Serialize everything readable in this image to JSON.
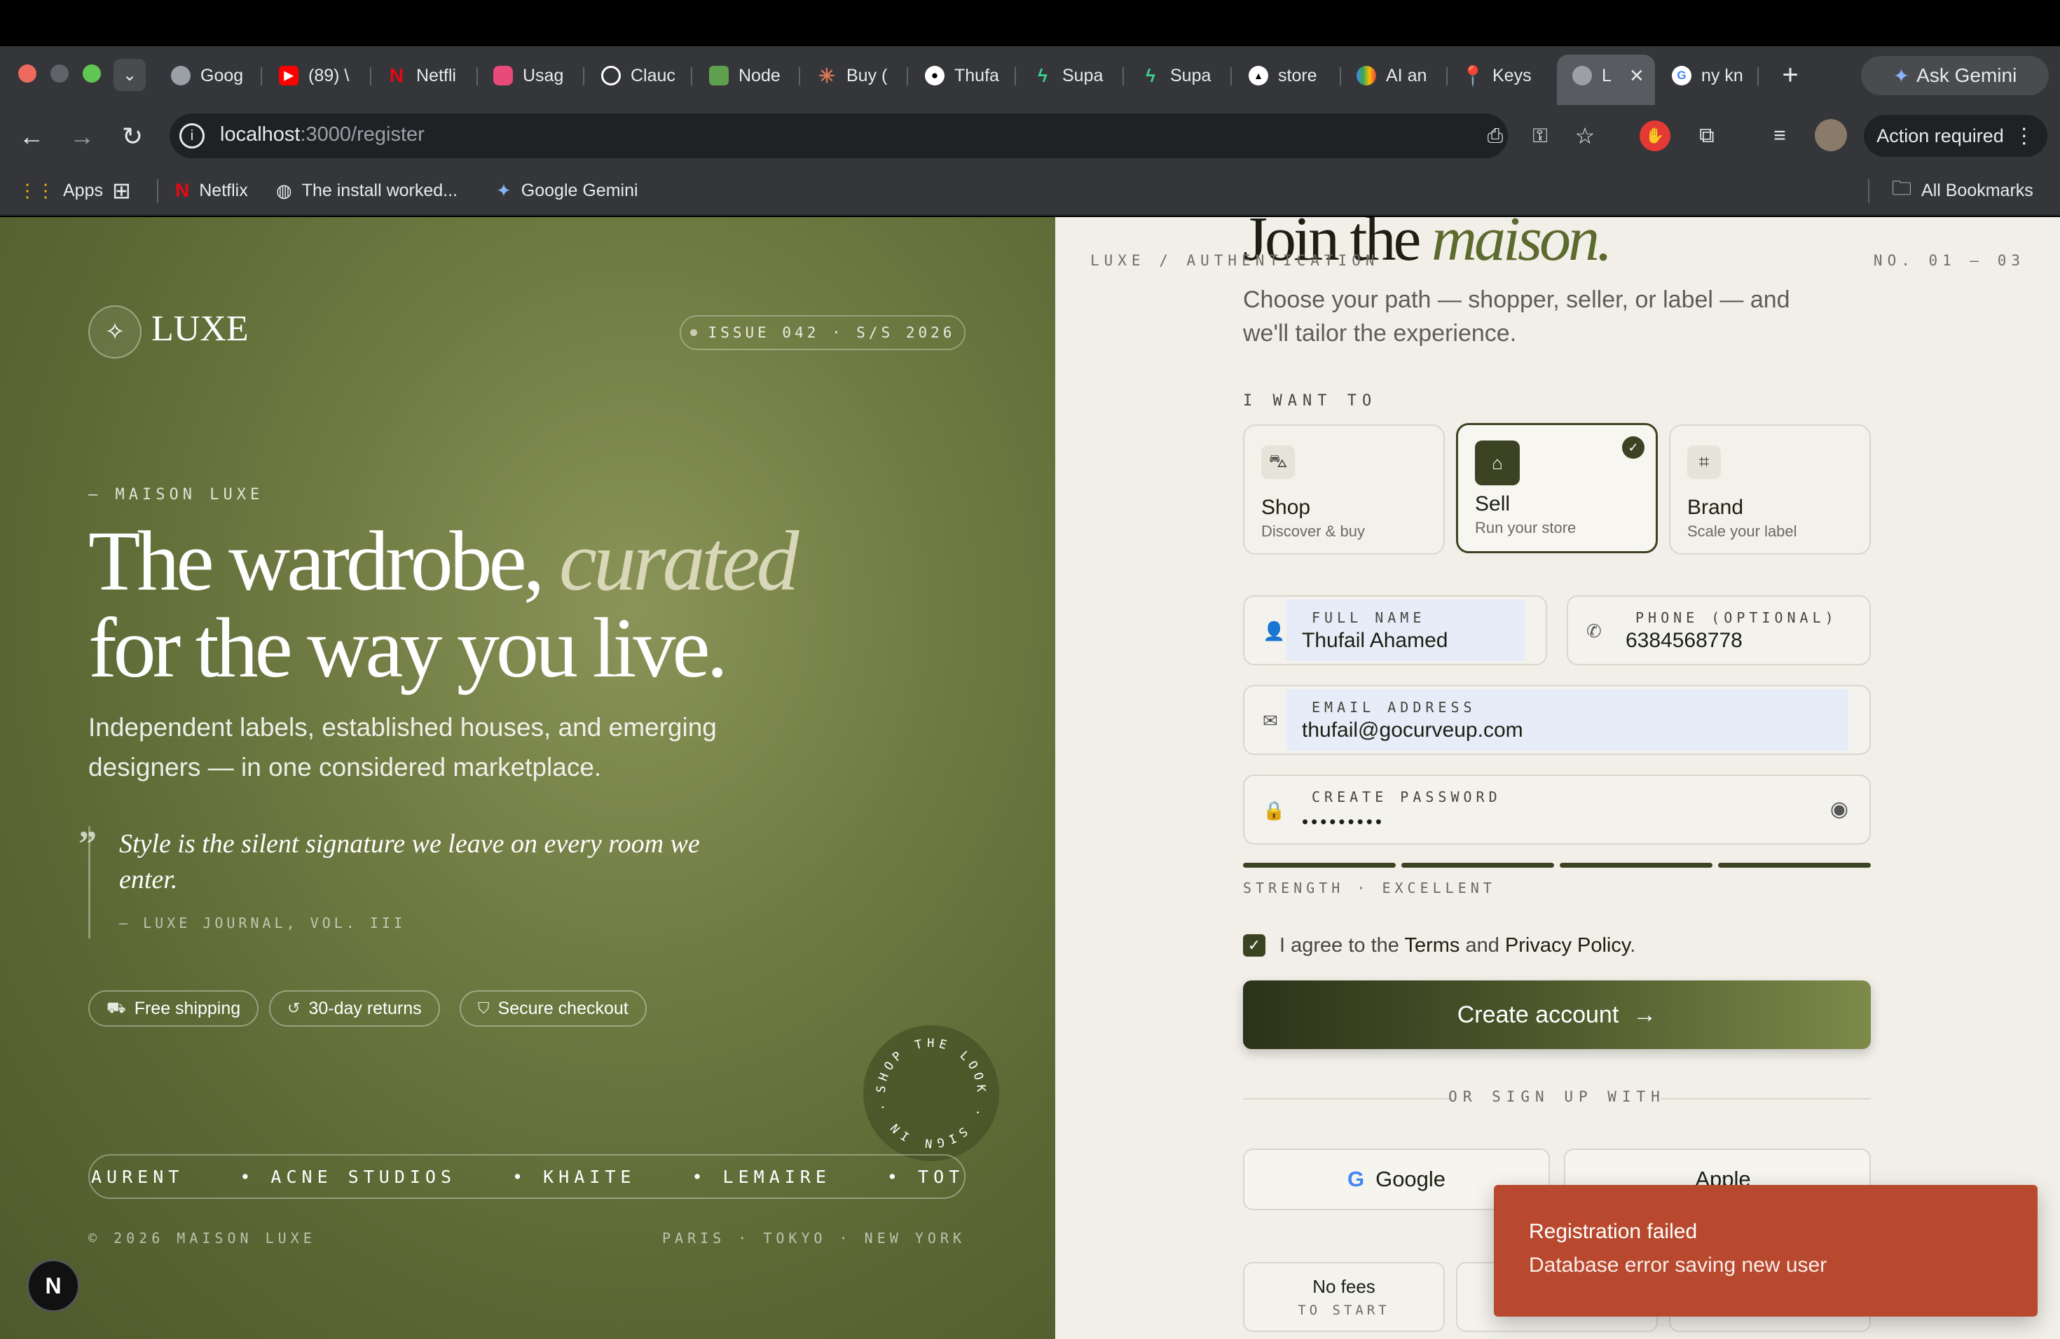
{
  "browser": {
    "tabs": [
      {
        "label": "Goog",
        "icon": "chrome-icon",
        "color": "#9aa0a6"
      },
      {
        "label": "(89) \\",
        "icon": "youtube-icon",
        "color": "#ff0000"
      },
      {
        "label": "Netfli",
        "icon": "netflix-icon",
        "color": "#e50914"
      },
      {
        "label": "Usag",
        "icon": "usage-icon",
        "color": "#e84a7a"
      },
      {
        "label": "Clauc",
        "icon": "openai-icon",
        "color": "#ffffff"
      },
      {
        "label": "Node",
        "icon": "node-icon",
        "color": "#5fa04e"
      },
      {
        "label": "Buy (",
        "icon": "claude-icon",
        "color": "#d97757"
      },
      {
        "label": "Thufa",
        "icon": "github-icon",
        "color": "#ffffff"
      },
      {
        "label": "Supa",
        "icon": "supabase-icon",
        "color": "#3ecf8e"
      },
      {
        "label": "Supa",
        "icon": "supabase-icon",
        "color": "#3ecf8e"
      },
      {
        "label": "store",
        "icon": "vercel-icon",
        "color": "#ffffff"
      },
      {
        "label": "AI an",
        "icon": "google-cloud-icon",
        "color": "#4285f4"
      },
      {
        "label": "Keys",
        "icon": "maps-icon",
        "color": "#ea4335"
      }
    ],
    "active_tab": {
      "label": "L",
      "close": "×"
    },
    "next_tab": {
      "label": "ny kn"
    },
    "new_tab": "+",
    "ask_gemini": "Ask Gemini",
    "url_host": "localhost",
    "url_path": ":3000/register",
    "action_required": "Action required",
    "bookmarks": [
      {
        "label": "Apps"
      },
      {
        "label": "Netflix"
      },
      {
        "label": "The install worked..."
      },
      {
        "label": "Google Gemini"
      }
    ],
    "all_bookmarks": "All Bookmarks"
  },
  "left": {
    "logo": "LUXE",
    "issue": "ISSUE 042 · S/S 2026",
    "eyebrow": "— MAISON LUXE",
    "headline_a": "The wardrobe,",
    "headline_em": "curated",
    "headline_b": "for the way you live.",
    "lead": "Independent labels, established houses, and emerging designers — in one considered marketplace.",
    "quote": "Style is the silent signature we leave on every room we enter.",
    "quote_source": "— LUXE JOURNAL, VOL. III",
    "chips": [
      "Free shipping",
      "30-day returns",
      "Secure checkout"
    ],
    "brands": [
      "AURENT",
      "• ACNE STUDIOS",
      "• KHAITE",
      "• LEMAIRE",
      "• TOTEME"
    ],
    "badge_text": "SHOP THE LOOK · SIGN IN ·",
    "footer_left": "© 2026 MAISON LUXE",
    "footer_right": "PARIS · TOKYO · NEW YORK",
    "next_badge": "N"
  },
  "right": {
    "crumb": "LUXE / AUTHENTICATION",
    "step": "NO. 01 — 03",
    "title_a": "Join the",
    "title_em": "maison.",
    "subtitle": "Choose your path — shopper, seller, or label — and we'll tailor the experience.",
    "i_want": "I WANT TO",
    "roles": [
      {
        "title": "Shop",
        "sub": "Discover & buy",
        "icon": "shopping-bag-icon"
      },
      {
        "title": "Sell",
        "sub": "Run your store",
        "icon": "store-icon",
        "selected": true
      },
      {
        "title": "Brand",
        "sub": "Scale your label",
        "icon": "tag-icon"
      }
    ],
    "fields": {
      "full_name": {
        "label": "FULL NAME",
        "value": "Thufail Ahamed"
      },
      "phone": {
        "label": "PHONE (OPTIONAL)",
        "value": "6384568778"
      },
      "email": {
        "label": "EMAIL ADDRESS",
        "value": "thufail@gocurveup.com"
      },
      "password": {
        "label": "CREATE PASSWORD",
        "value": "•••••••••"
      }
    },
    "strength_label": "STRENGTH · EXCELLENT",
    "strength_level": 1.0,
    "agree_pre": "I agree to the ",
    "agree_terms": "Terms",
    "agree_and": " and ",
    "agree_privacy": "Privacy Policy",
    "agree_post": ".",
    "cta": "Create account",
    "or_label": "OR SIGN UP WITH",
    "social": [
      "Google",
      "Apple"
    ],
    "perks": [
      {
        "title": "No fees",
        "sub": "TO START"
      }
    ]
  },
  "toast": {
    "title": "Registration failed",
    "desc": "Database error saving new user"
  }
}
